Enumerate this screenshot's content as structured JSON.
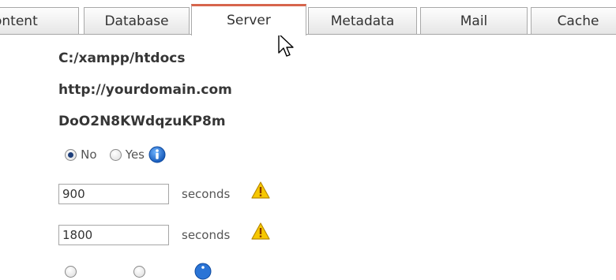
{
  "tabs": [
    {
      "label": "ontent"
    },
    {
      "label": "Database"
    },
    {
      "label": "Server",
      "active": true
    },
    {
      "label": "Metadata"
    },
    {
      "label": "Mail"
    },
    {
      "label": "Cache"
    }
  ],
  "server": {
    "path": "C:/xampp/htdocs",
    "live_site": "http://yourdomain.com",
    "secret": "DoO2N8KWdqzuKP8m",
    "radio_row": {
      "option_no": "No",
      "option_yes": "Yes",
      "selected": "No"
    },
    "lifetime_1": {
      "value": "900",
      "unit": "seconds"
    },
    "lifetime_2": {
      "value": "1800",
      "unit": "seconds"
    }
  },
  "colors": {
    "active_tab_accent": "#d7654c",
    "info_blue": "#1a6fd0",
    "warning_yellow": "#f5c400"
  },
  "icons": [
    "info-icon",
    "warning-icon",
    "mouse-pointer-icon"
  ]
}
